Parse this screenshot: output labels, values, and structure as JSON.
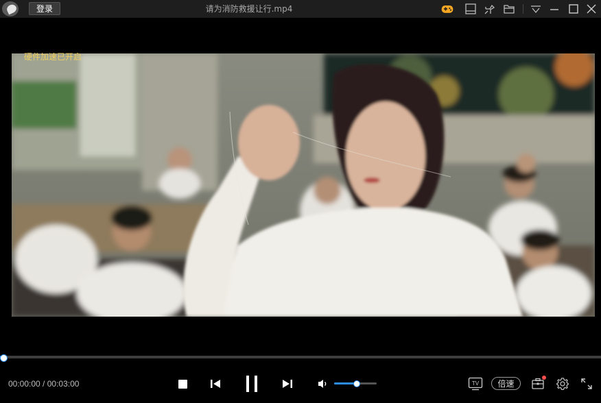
{
  "app": {
    "login_label": "登录",
    "file_title": "请为消防救援让行.mp4"
  },
  "titlebar_icons": [
    "gamepad-icon",
    "playlist-icon",
    "pin-icon",
    "folder-icon",
    "menu-icon",
    "minimize-icon",
    "maximize-icon",
    "close-icon"
  ],
  "video": {
    "overlay_text": "硬件加速已开启"
  },
  "playback": {
    "current_time": "00:00:00",
    "separator": " / ",
    "total_time": "00:03:00",
    "progress": 0.0,
    "volume": 0.52
  },
  "controls": {
    "speed_label": "倍速",
    "tv_label": "TV"
  },
  "colors": {
    "accent": "#2d8cf0",
    "overlay_text": "#f0d060",
    "gamepad": "#f5a623",
    "badge": "#ff4d4d"
  }
}
